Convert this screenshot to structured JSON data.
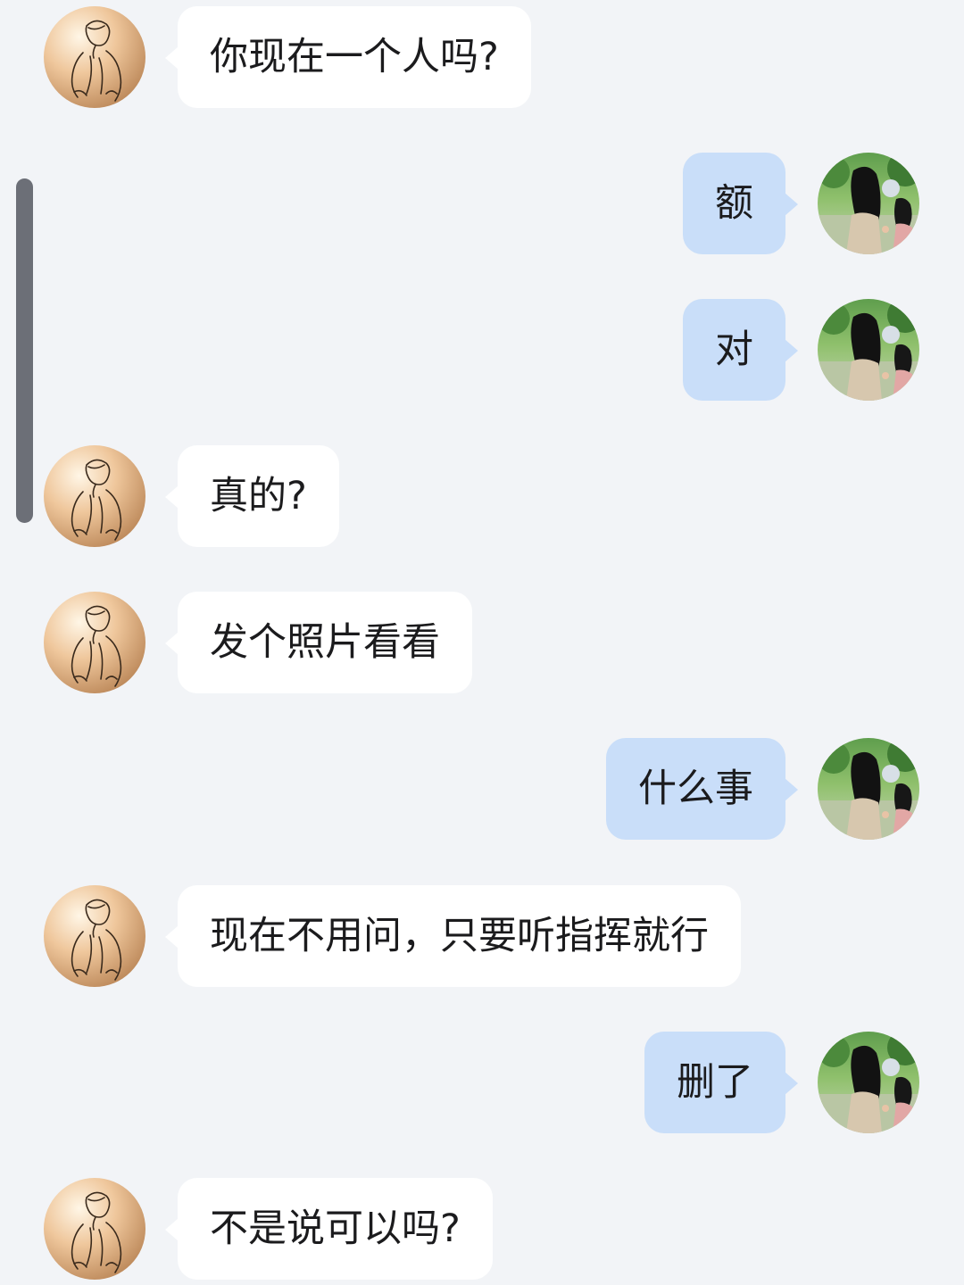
{
  "conversation": {
    "messages": [
      {
        "side": "in",
        "text": "你现在一个人吗?",
        "avatar_icon": "sketch-boy-avatar-icon"
      },
      {
        "side": "out",
        "text": "额",
        "avatar_icon": "girl-photo-avatar-icon"
      },
      {
        "side": "out",
        "text": "对",
        "avatar_icon": "girl-photo-avatar-icon"
      },
      {
        "side": "in",
        "text": "真的?",
        "avatar_icon": "sketch-boy-avatar-icon"
      },
      {
        "side": "in",
        "text": "发个照片看看",
        "avatar_icon": "sketch-boy-avatar-icon"
      },
      {
        "side": "out",
        "text": "什么事",
        "avatar_icon": "girl-photo-avatar-icon"
      },
      {
        "side": "in",
        "text": "现在不用问，只要听指挥就行",
        "avatar_icon": "sketch-boy-avatar-icon"
      },
      {
        "side": "out",
        "text": "删了",
        "avatar_icon": "girl-photo-avatar-icon"
      },
      {
        "side": "in",
        "text": "不是说可以吗?",
        "avatar_icon": "sketch-boy-avatar-icon"
      }
    ]
  },
  "colors": {
    "background": "#f2f4f7",
    "incoming_bubble": "#ffffff",
    "outgoing_bubble": "#c9def9",
    "text": "#1b1b1d",
    "scrollbar": "#6c6f77"
  }
}
